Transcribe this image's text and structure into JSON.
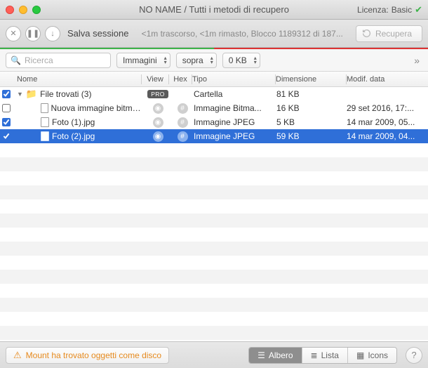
{
  "window": {
    "title": "NO NAME / Tutti i metodi di recupero",
    "license_label": "Licenza:",
    "license_value": "Basic"
  },
  "toolbar": {
    "save_session": "Salva sessione",
    "status": "<1m trascorso, <1m rimasto, Blocco 1189312 di 187...",
    "recover": "Recupera"
  },
  "filters": {
    "search_placeholder": "Ricerca",
    "type": "Immagini",
    "position": "sopra",
    "size": "0 KB"
  },
  "columns": {
    "name": "Nome",
    "view": "View",
    "hex": "Hex",
    "type": "Tipo",
    "size": "Dimensione",
    "date": "Modif. data"
  },
  "group": {
    "name": "File trovati (3)",
    "badge": "PRO",
    "type": "Cartella",
    "size": "81 KB",
    "checked": "mixed"
  },
  "files": [
    {
      "checked": false,
      "name": "Nuova immagine bitmap.bmp",
      "type": "Immagine Bitma...",
      "size": "16 KB",
      "date": "29 set 2016, 17:..."
    },
    {
      "checked": true,
      "name": "Foto (1).jpg",
      "type": "Immagine JPEG",
      "size": "5 KB",
      "date": "14 mar 2009, 05..."
    },
    {
      "checked": true,
      "name": "Foto (2).jpg",
      "type": "Immagine JPEG",
      "size": "59 KB",
      "date": "14 mar 2009, 04...",
      "selected": true
    }
  ],
  "footer": {
    "mount": "Mount ha trovato oggetti come disco",
    "views": {
      "tree": "Albero",
      "list": "Lista",
      "icons": "Icons"
    }
  }
}
